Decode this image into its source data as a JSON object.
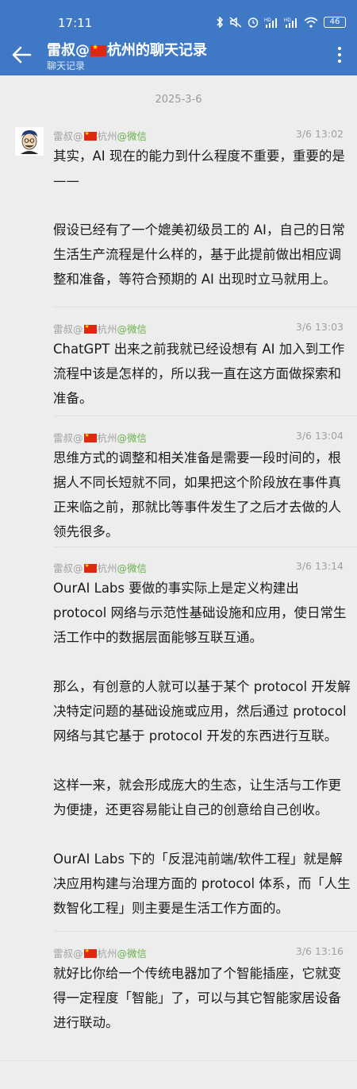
{
  "status_bar": {
    "time": "17:11",
    "battery": "46",
    "icons": [
      "bluetooth-icon",
      "mute-icon",
      "alarm-icon",
      "signal-hd-icon",
      "signal-hd-icon",
      "wifi-icon",
      "battery-icon"
    ]
  },
  "header": {
    "title_prefix": "雷叔@",
    "title_suffix": "杭州的聊天记录",
    "subtitle": "聊天记录",
    "background": "#3f79c6"
  },
  "date_separator": "2025-3-6",
  "messages": [
    {
      "sender_prefix": "雷叔@",
      "sender_city": "杭州",
      "sender_source": "@微信",
      "time": "3/6  13:02",
      "paragraphs": [
        "其实，AI 现在的能力到什么程度不重要，重要的是——",
        "假设已经有了一个媲美初级员工的 AI，自己的日常生活生产流程是什么样的，基于此提前做出相应调整和准备，等符合预期的 AI 出现时立马就用上。"
      ]
    },
    {
      "sender_prefix": "雷叔@",
      "sender_city": "杭州",
      "sender_source": "@微信",
      "time": "3/6  13:03",
      "paragraphs": [
        "ChatGPT 出来之前我就已经设想有 AI 加入到工作流程中该是怎样的，所以我一直在这方面做探索和准备。"
      ]
    },
    {
      "sender_prefix": "雷叔@",
      "sender_city": "杭州",
      "sender_source": "@微信",
      "time": "3/6  13:04",
      "paragraphs": [
        "思维方式的调整和相关准备是需要一段时间的，根据人不同长短就不同，如果把这个阶段放在事件真正来临之前，那就比等事件发生了之后才去做的人领先很多。"
      ]
    },
    {
      "sender_prefix": "雷叔@",
      "sender_city": "杭州",
      "sender_source": "@微信",
      "time": "3/6  13:14",
      "paragraphs": [
        "OurAI Labs 要做的事实际上是定义构建出 protocol 网络与示范性基础设施和应用，使日常生活工作中的数据层面能够互联互通。",
        "那么，有创意的人就可以基于某个 protocol 开发解决特定问题的基础设施或应用，然后通过 protocol 网络与其它基于 protocol 开发的东西进行互联。",
        "这样一来，就会形成庞大的生态，让生活与工作更为便捷，还更容易能让自己的创意给自己创收。",
        "OurAI Labs 下的「反混沌前端/软件工程」就是解决应用构建与治理方面的 protocol 体系，而「人生数智化工程」则主要是生活工作方面的。"
      ]
    },
    {
      "sender_prefix": "雷叔@",
      "sender_city": "杭州",
      "sender_source": "@微信",
      "time": "3/6  13:16",
      "paragraphs": [
        "就好比你给一个传统电器加了个智能插座，它就变得一定程度「智能」了，可以与其它智能家居设备进行联动。"
      ]
    }
  ]
}
